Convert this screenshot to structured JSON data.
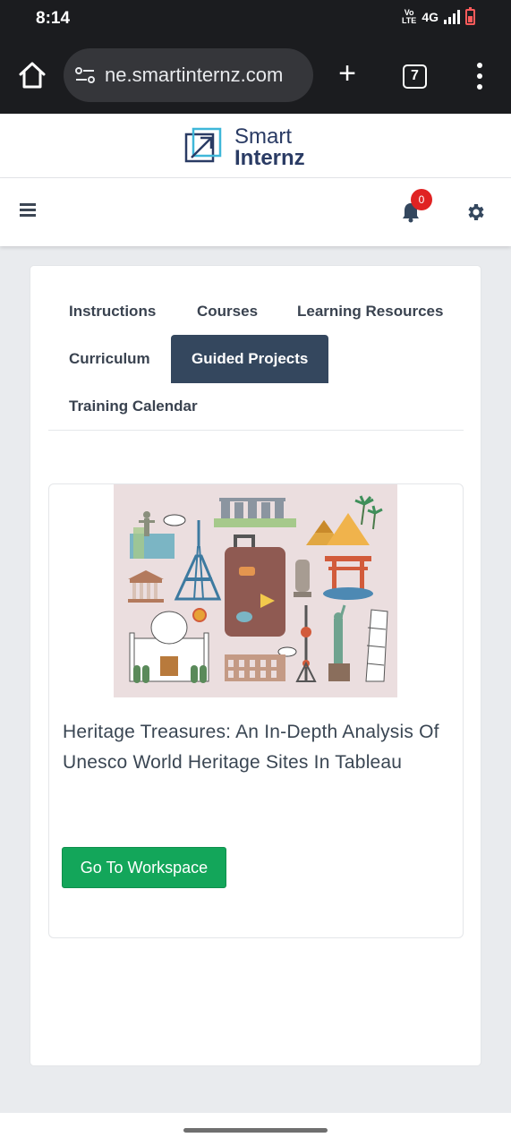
{
  "status_bar": {
    "time": "8:14",
    "volte_top": "Vo",
    "volte_bottom": "LTE",
    "network": "4G"
  },
  "browser": {
    "url": "ne.smartinternz.com",
    "tab_count": "7"
  },
  "logo": {
    "line1": "Smart",
    "line2": "Internz"
  },
  "nav": {
    "notification_count": "0"
  },
  "tabs": [
    {
      "label": "Instructions",
      "active": false
    },
    {
      "label": "Courses",
      "active": false
    },
    {
      "label": "Learning Resources",
      "active": false
    },
    {
      "label": "Curriculum",
      "active": false
    },
    {
      "label": "Guided Projects",
      "active": true
    },
    {
      "label": "Training Calendar",
      "active": false
    }
  ],
  "project": {
    "title": "Heritage Treasures: An In-Depth Analysis Of Unesco World Heritage Sites In Tableau",
    "button_label": "Go To Workspace"
  },
  "colors": {
    "accent": "#34475e",
    "button_green": "#13a65a",
    "badge_red": "#e02323",
    "brand_navy": "#2a3b64"
  }
}
